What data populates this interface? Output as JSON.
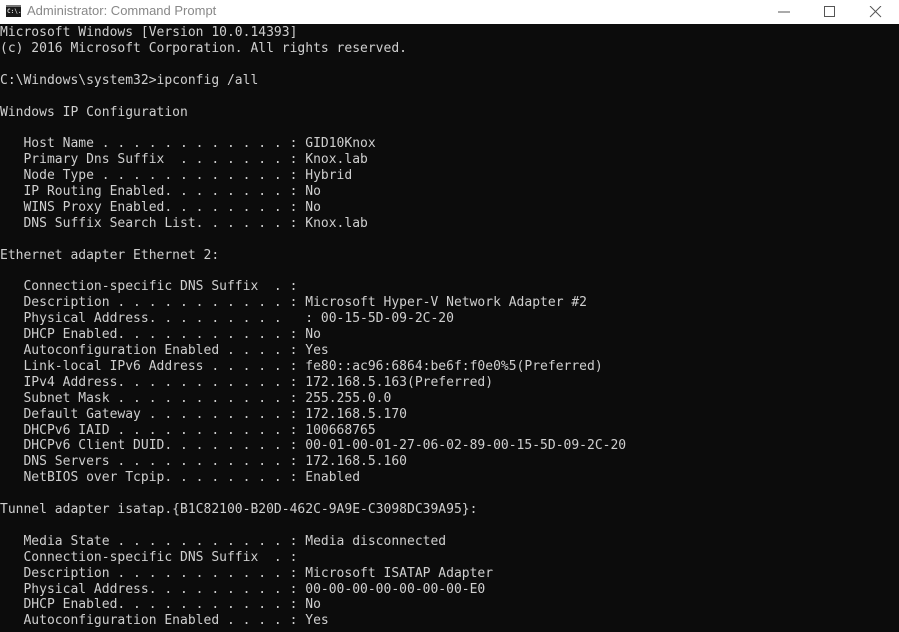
{
  "window": {
    "title": "Administrator: Command Prompt",
    "app_icon_text": "C:\\.",
    "controls": [
      "minimize",
      "maximize",
      "close"
    ]
  },
  "terminal": {
    "lines": [
      "Microsoft Windows [Version 10.0.14393]",
      "(c) 2016 Microsoft Corporation. All rights reserved.",
      "",
      "C:\\Windows\\system32>ipconfig /all",
      "",
      "Windows IP Configuration",
      "",
      "   Host Name . . . . . . . . . . . . : GID10Knox",
      "   Primary Dns Suffix  . . . . . . . : Knox.lab",
      "   Node Type . . . . . . . . . . . . : Hybrid",
      "   IP Routing Enabled. . . . . . . . : No",
      "   WINS Proxy Enabled. . . . . . . . : No",
      "   DNS Suffix Search List. . . . . . : Knox.lab",
      "",
      "Ethernet adapter Ethernet 2:",
      "",
      "   Connection-specific DNS Suffix  . :",
      "   Description . . . . . . . . . . . : Microsoft Hyper-V Network Adapter #2",
      "   Physical Address. . . . . . . . .   : 00-15-5D-09-2C-20",
      "   DHCP Enabled. . . . . . . . . . . : No",
      "   Autoconfiguration Enabled . . . . : Yes",
      "   Link-local IPv6 Address . . . . . : fe80::ac96:6864:be6f:f0e0%5(Preferred)",
      "   IPv4 Address. . . . . . . . . . . : 172.168.5.163(Preferred)",
      "   Subnet Mask . . . . . . . . . . . : 255.255.0.0",
      "   Default Gateway . . . . . . . . . : 172.168.5.170",
      "   DHCPv6 IAID . . . . . . . . . . . : 100668765",
      "   DHCPv6 Client DUID. . . . . . . . : 00-01-00-01-27-06-02-89-00-15-5D-09-2C-20",
      "   DNS Servers . . . . . . . . . . . : 172.168.5.160",
      "   NetBIOS over Tcpip. . . . . . . . : Enabled",
      "",
      "Tunnel adapter isatap.{B1C82100-B20D-462C-9A9E-C3098DC39A95}:",
      "",
      "   Media State . . . . . . . . . . . : Media disconnected",
      "   Connection-specific DNS Suffix  . :",
      "   Description . . . . . . . . . . . : Microsoft ISATAP Adapter",
      "   Physical Address. . . . . . . . . : 00-00-00-00-00-00-00-E0",
      "   DHCP Enabled. . . . . . . . . . . : No",
      "   Autoconfiguration Enabled . . . . : Yes"
    ]
  }
}
